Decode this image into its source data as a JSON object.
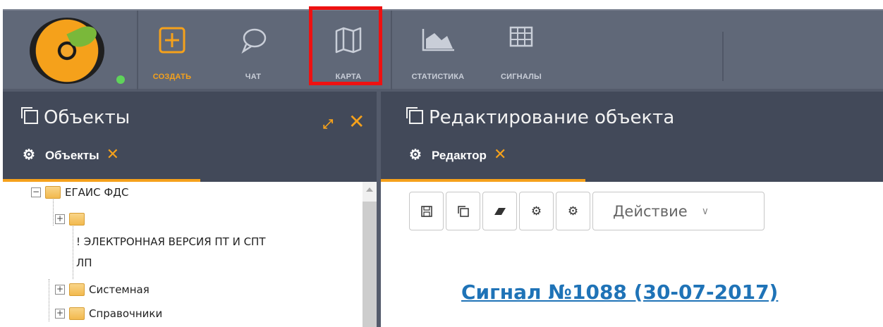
{
  "toolbar": {
    "items": [
      {
        "label": "СОЗДАТЬ",
        "icon": "plus-square-icon"
      },
      {
        "label": "ЧАТ",
        "icon": "chat-bubble-icon"
      },
      {
        "label": "КАРТА",
        "icon": "map-icon"
      },
      {
        "label": "СТАТИСТИКА",
        "icon": "area-chart-icon"
      },
      {
        "label": "СИГНАЛЫ",
        "icon": "grid-table-icon"
      }
    ],
    "accent_color": "#f5a11b",
    "highlight_color": "#ee1111"
  },
  "left_panel": {
    "title": "Объекты",
    "tab_label": "Объекты",
    "tab_close": "✕",
    "close": "✕",
    "tree": [
      {
        "label": "ЕГАИС ФДС",
        "expander": "−"
      },
      {
        "label": "",
        "expander": "+"
      },
      {
        "label": "! ЭЛЕКТРОННАЯ ВЕРСИЯ ПТ И СПТ"
      },
      {
        "label": "ЛП"
      },
      {
        "label": "Системная",
        "expander": "+"
      },
      {
        "label": "Справочники",
        "expander": "+"
      }
    ]
  },
  "right_panel": {
    "title": "Редактирование объекта",
    "tab_label": "Редактор",
    "tab_close": "✕",
    "action_select": "Действие",
    "signal_link": "Сигнал №1088 (30-07-2017)"
  }
}
